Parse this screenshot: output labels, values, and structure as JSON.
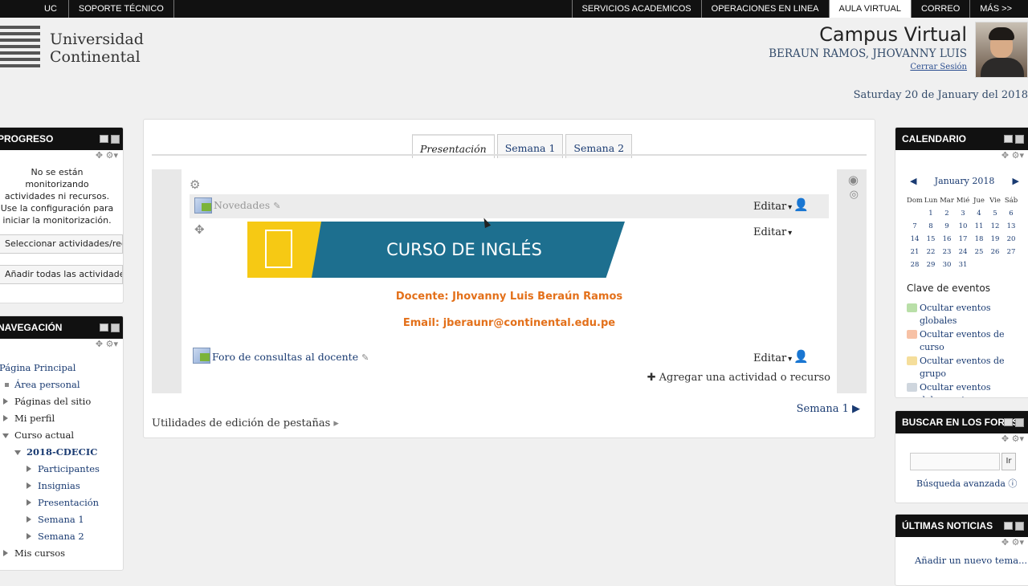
{
  "topbar": {
    "left": [
      "UC",
      "SOPORTE TÉCNICO"
    ],
    "right": [
      "SERVICIOS ACADEMICOS",
      "OPERACIONES EN LINEA",
      "AULA VIRTUAL",
      "CORREO",
      "MÁS >>"
    ],
    "active": "AULA VIRTUAL"
  },
  "header": {
    "logo_line1": "Universidad",
    "logo_line2": "Continental",
    "campus_title": "Campus Virtual",
    "user_name": "BERAUN RAMOS, JHOVANNY LUIS",
    "logout": "Cerrar Sesión",
    "date": "Saturday 20 de January del 2018"
  },
  "progreso": {
    "title": "PROGRESO",
    "message": "No se están monitorizando actividades ni recursos. Use la configuración para iniciar la monitorización.",
    "btn_select": "Seleccionar actividades/recursos",
    "btn_add_all": "Añadir todas las actividades/recursos"
  },
  "navegacion": {
    "title": "NAVEGACIÓN",
    "items": [
      {
        "label": "Página Principal"
      },
      {
        "label": "Área personal"
      },
      {
        "label": "Páginas del sitio"
      },
      {
        "label": "Mi perfil"
      },
      {
        "label": "Curso actual"
      },
      {
        "label": "2018-CDECIC"
      },
      {
        "label": "Participantes"
      },
      {
        "label": "Insignias"
      },
      {
        "label": "Presentación"
      },
      {
        "label": "Semana 1"
      },
      {
        "label": "Semana 2"
      },
      {
        "label": "Mis cursos"
      }
    ]
  },
  "course": {
    "tabs": [
      "Presentación",
      "Semana 1",
      "Semana 2"
    ],
    "active_tab": "Presentación",
    "novedades": "Novedades",
    "editar": "Editar",
    "banner_text": "CURSO DE INGLÉS",
    "docente": "Docente: Jhovanny Luis Beraún Ramos",
    "email": "Email: jberaunr@continental.edu.pe",
    "foro": "Foro de consultas al docente",
    "add_activity": "Agregar una actividad o recurso",
    "next_section": "Semana 1",
    "utilities": "Utilidades de edición de pestañas"
  },
  "calendario": {
    "title": "CALENDARIO",
    "month": "January 2018",
    "days": [
      "Dom",
      "Lun",
      "Mar",
      "Mié",
      "Jue",
      "Vie",
      "Sáb"
    ],
    "weeks": [
      [
        "",
        "1",
        "2",
        "3",
        "4",
        "5",
        "6"
      ],
      [
        "7",
        "8",
        "9",
        "10",
        "11",
        "12",
        "13"
      ],
      [
        "14",
        "15",
        "16",
        "17",
        "18",
        "19",
        "20"
      ],
      [
        "21",
        "22",
        "23",
        "24",
        "25",
        "26",
        "27"
      ],
      [
        "28",
        "29",
        "30",
        "31",
        "",
        "",
        ""
      ]
    ],
    "key_title": "Clave de eventos",
    "events": [
      {
        "label": "Ocultar eventos globales",
        "color": "#b9dfa8"
      },
      {
        "label": "Ocultar eventos de curso",
        "color": "#f7c1a5"
      },
      {
        "label": "Ocultar eventos de grupo",
        "color": "#f5de9b"
      },
      {
        "label": "Ocultar eventos del usuario",
        "color": "#cfd6de"
      }
    ]
  },
  "buscar": {
    "title": "BUSCAR EN LOS FOROS",
    "go": "Ir",
    "advanced": "Búsqueda avanzada"
  },
  "noticias": {
    "title": "ÚLTIMAS NOTICIAS",
    "add": "Añadir un nuevo tema..."
  }
}
